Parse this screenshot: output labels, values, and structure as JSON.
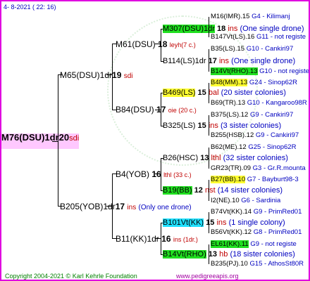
{
  "header": {
    "date": "4-  8-2021 (  22:  16)"
  },
  "root": {
    "code": "M76(DSU)1dr",
    "year": "20",
    "line": "sdi"
  },
  "sire": {
    "code": "M65(DSU)1dr",
    "num": "19",
    "tag": "sdi"
  },
  "dam": {
    "code": "B205(YOB)1dr",
    "num": "17",
    "tag": "ins",
    "note": "(Only one drone)"
  },
  "ss": {
    "code": "M61(DSU)",
    "num": "18",
    "tag": "leyh(7 c.)"
  },
  "sd": {
    "code": "B84(DSU)",
    "num": "17",
    "tag": "oie (20 c.)"
  },
  "ds": {
    "code": "B4(YOB)",
    "num": "16",
    "tag": "lthl (33 c.)"
  },
  "dd": {
    "code": "B11(KK)1dr",
    "num": "16",
    "tag": "ins (1dr.)"
  },
  "g3": [
    {
      "code": "M307(DSU)1dr",
      "num": "18",
      "tag": "ins",
      "note": "(One single drone)"
    },
    {
      "code": "B114(LS)1dr",
      "num": "17",
      "tag": "ins",
      "note": "(One single drone)"
    },
    {
      "code": "B469(LS)",
      "num": "15",
      "tag": "bal",
      "note": "(20 sister colonies)"
    },
    {
      "code": "B325(LS)",
      "num": "15",
      "tag": "ins",
      "note": "(3 sister colonies)"
    },
    {
      "code": "B26(HSC)",
      "num": "13",
      "tag": "lthl",
      "note": "(32 sister colonies)"
    },
    {
      "code": "B19(BB)",
      "num": "12",
      "tag": "nst",
      "note": "(14 sister colonies)"
    },
    {
      "code": "B101Vt(KK)",
      "num": "15",
      "tag": "ins",
      "note": "(1 single colony)"
    },
    {
      "code": "B14Vt(RHO)",
      "num": "13",
      "tag": "hb",
      "note": "(18 sister colonies)"
    }
  ],
  "col5": [
    {
      "text": "M16(IMR).15",
      "note": "G4 - Kilimanj",
      "hl": ""
    },
    {
      "text": "B147Vt(LS).16",
      "note": "G11 - not registe",
      "hl": ""
    },
    {
      "text": "B35(LS).15",
      "note": "G10 - Cankiri97",
      "hl": ""
    },
    {
      "text": "B14Vt(RHO).13",
      "note": "G10 - not registe",
      "hl": "#20e020"
    },
    {
      "text": "B48(MM).13",
      "note": "G24 - Sinop62R",
      "hl": "#ffff30"
    },
    {
      "text": "B69(TR).13",
      "note": "G10 - Kangaroo98R",
      "hl": ""
    },
    {
      "text": "B375(LS).12",
      "note": "G9 - Cankiri97",
      "hl": ""
    },
    {
      "text": "B255(HSB).12",
      "note": "G9 - Cankiri97",
      "hl": ""
    },
    {
      "text": "B62(ME).12",
      "note": "G25 - Sinop62R",
      "hl": ""
    },
    {
      "text": "GR23(TR).09",
      "note": "G3 - Gr.R.mounta",
      "hl": ""
    },
    {
      "text": "B27(BB).10",
      "note": "G7 - Bayburt98-3",
      "hl": "#ffff30"
    },
    {
      "text": "I2(NE).10",
      "note": "G6 - Sardinia",
      "hl": ""
    },
    {
      "text": "B74Vt(KK).14",
      "note": "G9 - PrimRed01",
      "hl": ""
    },
    {
      "text": "B56Vt(KK).12",
      "note": "G8 - PrimRed01",
      "hl": ""
    },
    {
      "text": "EL61(KK).11",
      "note": "G9 - not registe",
      "hl": "#20e020"
    },
    {
      "text": "B235(PJ).10",
      "note": "G15 - AthosSt80R",
      "hl": ""
    }
  ],
  "footer": {
    "copyright": "Copyright 2004-2021 © Karl Kehrle Foundation",
    "url": "www.pedigreeapis.org"
  }
}
